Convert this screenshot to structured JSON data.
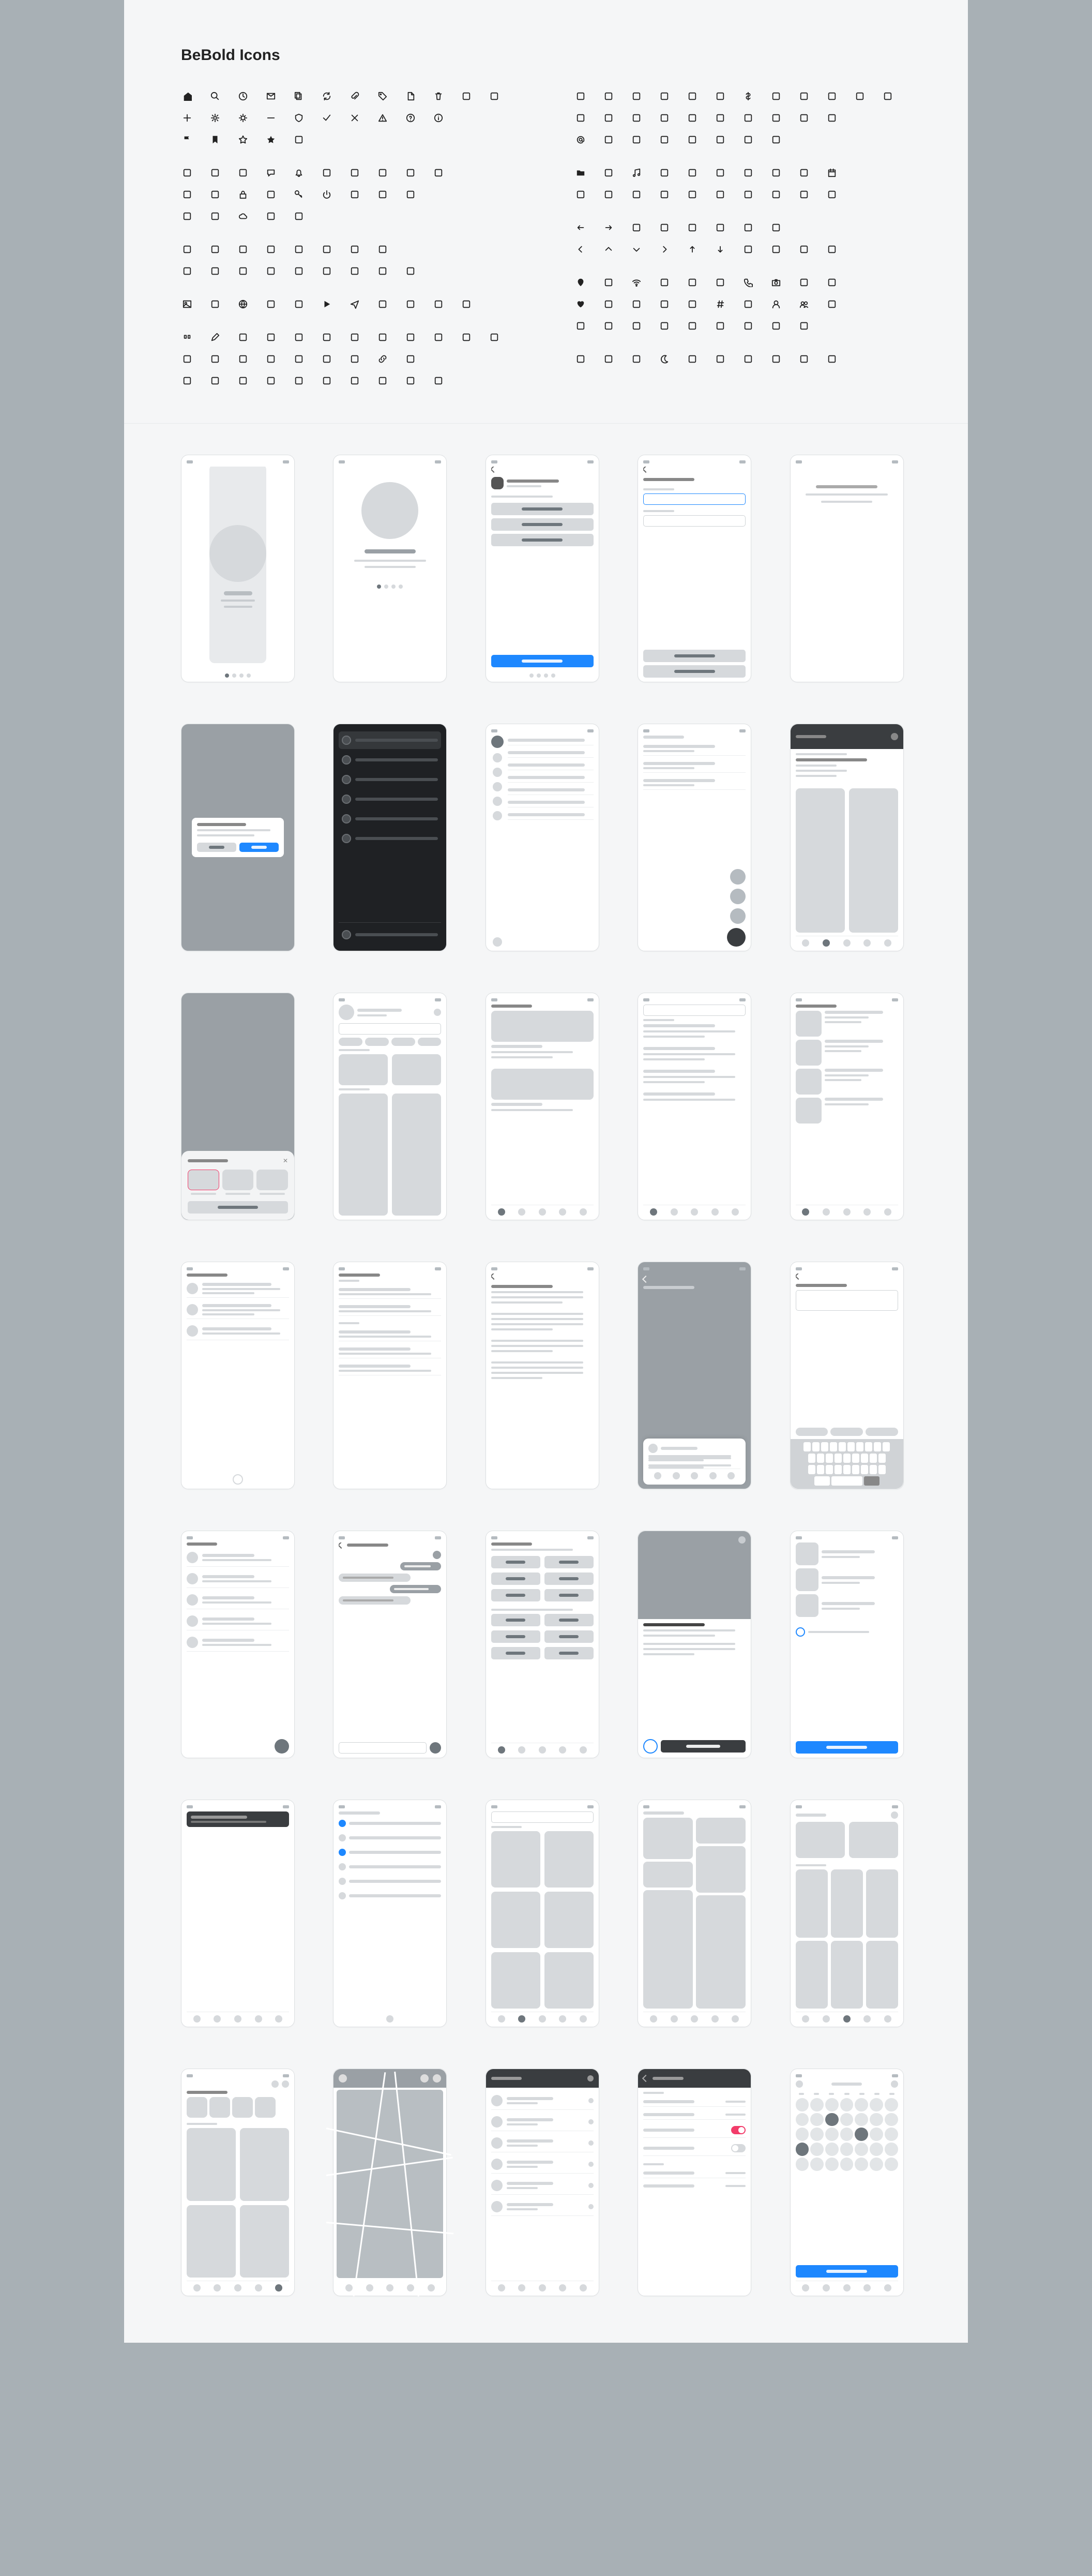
{
  "page_title": "BeBold Icons",
  "icon_groups_left": [
    [
      "home",
      "search",
      "clock",
      "mail",
      "copy",
      "refresh",
      "paperclip",
      "tag",
      "file",
      "trash",
      "filter-funnel",
      "save"
    ],
    [
      "plus",
      "gear",
      "sun",
      "minus",
      "shield",
      "check",
      "x-mark",
      "warning",
      "help",
      "info"
    ],
    [
      "flag",
      "bookmark",
      "star-outline",
      "star-filled",
      "sparkle"
    ],
    [],
    [
      "toggle-off",
      "toggle-on",
      "target",
      "chat",
      "bell",
      "crosshair",
      "battery",
      "stack",
      "droplet",
      "flashlight"
    ],
    [
      "zap",
      "cart",
      "lock",
      "lock-open",
      "key",
      "power",
      "log-out",
      "log-in",
      "tv"
    ],
    [
      "bag",
      "printer",
      "cloud",
      "upload",
      "download"
    ],
    [],
    [
      "grid-dots",
      "list",
      "columns",
      "menu",
      "more-h",
      "more-v",
      "col-list",
      "h-scroll"
    ],
    [
      "layout-1",
      "layout-2",
      "layout-3",
      "layout-4",
      "layout-5",
      "layout-6",
      "layout-7",
      "layout-8",
      "layout-9"
    ],
    [],
    [
      "image",
      "message",
      "globe",
      "inbox",
      "archive",
      "play",
      "send",
      "compass",
      "smile",
      "frown",
      "clock2"
    ],
    [],
    [
      "quote",
      "pen",
      "brush",
      "text-size",
      "heading",
      "italic",
      "bold",
      "underline",
      "strike",
      "code",
      "cursor",
      "h1"
    ],
    [
      "align-left",
      "align-center",
      "align-right",
      "filter",
      "grid-icon",
      "list-icon",
      "paint",
      "link2",
      "attach"
    ],
    [
      "minimize",
      "maximize",
      "crop",
      "grid-4",
      "layers",
      "rotate",
      "refresh2",
      "pin",
      "expand",
      "shrink"
    ]
  ],
  "icon_groups_right": [
    [
      "window",
      "stack2",
      "text-doc",
      "note",
      "receipt",
      "doc",
      "dollar",
      "euro",
      "pound",
      "toggle2",
      "trash2",
      "percent2"
    ],
    [
      "sidebar-l",
      "sidebar-r",
      "dashboard",
      "contrast",
      "brightness",
      "snowflake",
      "mic",
      "type",
      "heading2",
      "percent"
    ],
    [
      "at",
      "thermometer",
      "moon2",
      "sun2",
      "asterisk",
      "command",
      "ruler",
      "t-cursor"
    ],
    [],
    [
      "folder",
      "folder-open",
      "music",
      "speaker",
      "volume",
      "rewind",
      "play2",
      "forward",
      "video",
      "calendar"
    ],
    [
      "folder-plus",
      "folder-minus",
      "file-plus",
      "film",
      "disc",
      "folder-x",
      "file-text",
      "folder-check",
      "file-code",
      "file-zip"
    ],
    [],
    [
      "arrow-left",
      "arrow-right",
      "swap-h",
      "repeat",
      "expand-out",
      "collapse-in",
      "shuffle",
      "swap"
    ],
    [
      "chevron-left",
      "chevron-up",
      "chevron-down",
      "chevron-right",
      "arrow-up",
      "arrow-down",
      "undo",
      "redo",
      "diag-up",
      "diag-down"
    ],
    [],
    [
      "location",
      "pin2",
      "wifi",
      "plane",
      "signal",
      "cast",
      "phone",
      "camera",
      "trash3",
      "mic2"
    ],
    [
      "heart",
      "heart-outline",
      "coffee",
      "thumbs-up",
      "thumbs-down",
      "hash",
      "mention",
      "user",
      "users",
      "user-plus"
    ],
    [
      "twitter",
      "facebook",
      "instagram",
      "youtube",
      "apple",
      "android",
      "tiktok",
      "linkedin",
      "github"
    ],
    [],
    [
      "hourglass",
      "circle-outline",
      "semicircle",
      "moon",
      "half",
      "square",
      "rotate-ccw",
      "person",
      "cloud2",
      "flame"
    ]
  ]
}
